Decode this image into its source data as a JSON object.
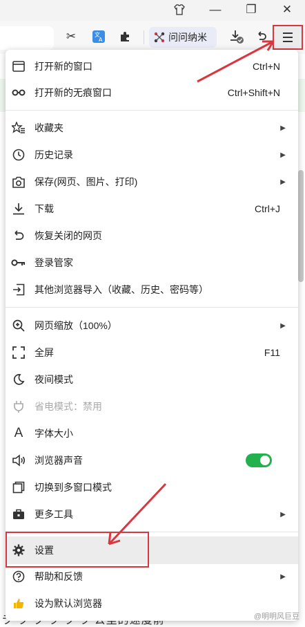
{
  "titlebar": {
    "shirt_icon": "shirt-icon",
    "minimize": "—",
    "restore": "❐",
    "close": "✕"
  },
  "toolbar": {
    "ask_label": "问问纳米"
  },
  "menu": {
    "items": [
      {
        "label": "打开新的窗口",
        "shortcut": "Ctrl+N",
        "icon": "window-icon"
      },
      {
        "label": "打开新的无痕窗口",
        "shortcut": "Ctrl+Shift+N",
        "icon": "incognito-icon"
      },
      {
        "label": "收藏夹",
        "icon": "star-list-icon",
        "submenu": true
      },
      {
        "label": "历史记录",
        "icon": "clock-icon",
        "submenu": true
      },
      {
        "label": "保存(网页、图片、打印)",
        "icon": "camera-icon",
        "submenu": true
      },
      {
        "label": "下载",
        "shortcut": "Ctrl+J",
        "icon": "download-icon"
      },
      {
        "label": "恢复关闭的网页",
        "icon": "undo-icon"
      },
      {
        "label": "登录管家",
        "icon": "key-icon"
      },
      {
        "label": "其他浏览器导入（收藏、历史、密码等）",
        "icon": "import-icon"
      },
      {
        "label": "网页缩放（100%）",
        "icon": "zoom-icon",
        "submenu": true
      },
      {
        "label": "全屏",
        "shortcut": "F11",
        "icon": "fullscreen-icon"
      },
      {
        "label": "夜间模式",
        "icon": "moon-icon"
      },
      {
        "label": "省电模式：禁用",
        "icon": "plug-icon",
        "disabled": true
      },
      {
        "label": "字体大小",
        "icon": "font-icon"
      },
      {
        "label": "浏览器声音",
        "icon": "speaker-icon",
        "toggle_on": true
      },
      {
        "label": "切换到多窗口模式",
        "icon": "multiwindow-icon"
      },
      {
        "label": "更多工具",
        "icon": "toolbox-icon",
        "submenu": true
      },
      {
        "label": "设置",
        "icon": "gear-icon"
      },
      {
        "label": "帮助和反馈",
        "icon": "help-icon",
        "submenu": true
      },
      {
        "label": "设为默认浏览器",
        "icon": "thumbs-up-icon"
      }
    ]
  },
  "background": {
    "snippet": "ラ ラ ラ ラ ラ ラ 公里的速度前"
  },
  "watermark": "@明明风巨豆",
  "colors": {
    "accent_red": "#d9363e",
    "toggle_green": "#22b14c"
  }
}
